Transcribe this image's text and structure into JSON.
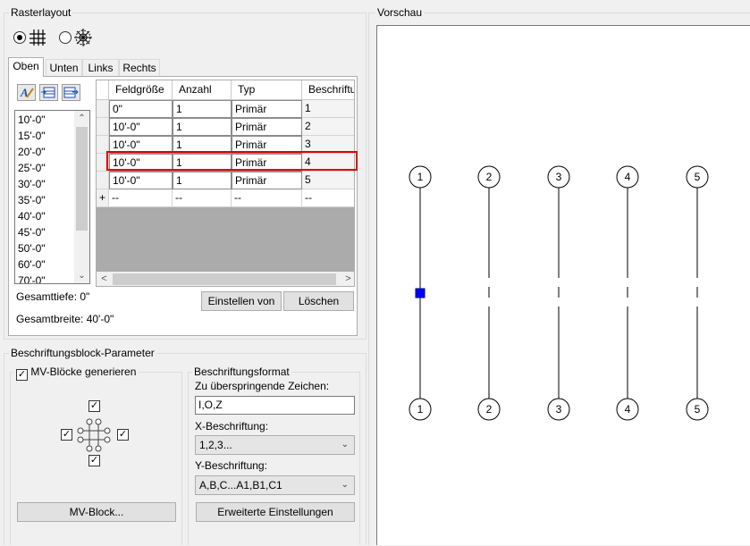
{
  "left_panel": {
    "raster_group_title": "Rasterlayout",
    "tabs": [
      "Oben",
      "Unten",
      "Links",
      "Rechts"
    ],
    "sizes_list": [
      "10'-0\"",
      "15'-0\"",
      "20'-0\"",
      "25'-0\"",
      "30'-0\"",
      "35'-0\"",
      "40'-0\"",
      "45'-0\"",
      "50'-0\"",
      "60'-0\"",
      "70'-0\""
    ],
    "table": {
      "headers": [
        "Feldgröße",
        "Anzahl",
        "Typ",
        "Beschriftun"
      ],
      "rows": [
        {
          "size": "0\"",
          "count": "1",
          "type": "Primär",
          "label": "1"
        },
        {
          "size": "10'-0\"",
          "count": "1",
          "type": "Primär",
          "label": "2"
        },
        {
          "size": "10'-0\"",
          "count": "1",
          "type": "Primär",
          "label": "3"
        },
        {
          "size": "10'-0\"",
          "count": "1",
          "type": "Primär",
          "label": "4"
        },
        {
          "size": "10'-0\"",
          "count": "1",
          "type": "Primär",
          "label": "5"
        }
      ],
      "new_row": {
        "marker": "+",
        "size": "--",
        "count": "--",
        "type": "--",
        "label": "--"
      }
    },
    "total_depth": "Gesamttiefe: 0\"",
    "total_width": "Gesamtbreite: 40'-0\"",
    "set_from_button": "Einstellen von",
    "delete_button": "Löschen"
  },
  "block_params": {
    "group_title": "Beschriftungsblock-Parameter",
    "generate_checkbox_label": "MV-Blöcke generieren",
    "generate_checked": true,
    "mv_block_button": "MV-Block...",
    "format_title": "Beschriftungsformat",
    "skip_chars_label": "Zu überspringende Zeichen:",
    "skip_chars_value": "I,O,Z",
    "x_label": "X-Beschriftung:",
    "x_value": "1,2,3...",
    "y_label": "Y-Beschriftung:",
    "y_value": "A,B,C...A1,B1,C1",
    "advanced_button": "Erweiterte Einstellungen"
  },
  "preview": {
    "title": "Vorschau",
    "bubbles": [
      "1",
      "2",
      "3",
      "4",
      "5"
    ],
    "handle_color": "#0000ff",
    "highlight_color": "#e00000"
  }
}
